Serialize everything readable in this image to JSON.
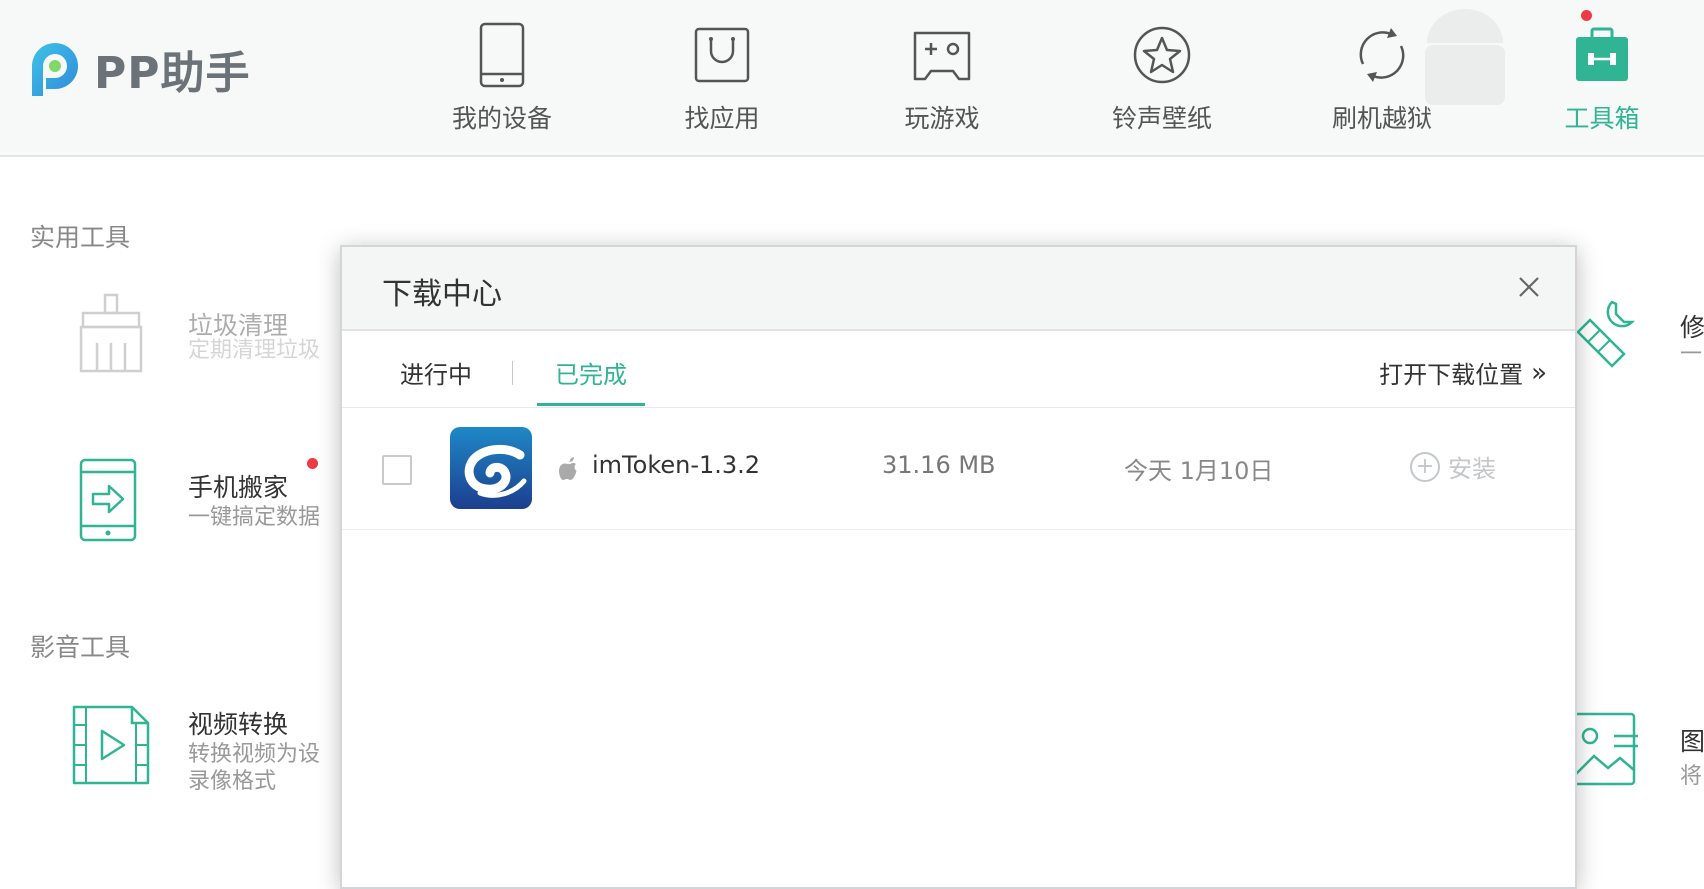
{
  "app": {
    "logo_text": "PP助手"
  },
  "nav": {
    "items": [
      {
        "label": "我的设备",
        "icon": "phone-icon"
      },
      {
        "label": "找应用",
        "icon": "shopping-bag-icon"
      },
      {
        "label": "玩游戏",
        "icon": "gamepad-icon"
      },
      {
        "label": "铃声壁纸",
        "icon": "star-icon"
      },
      {
        "label": "刷机越狱",
        "icon": "refresh-icon"
      },
      {
        "label": "工具箱",
        "icon": "toolbox-icon",
        "active": true
      }
    ]
  },
  "sections": {
    "utility_title": "实用工具",
    "media_title": "影音工具"
  },
  "tools": {
    "junk_clean": {
      "title": "垃圾清理",
      "desc": "定期清理垃圾"
    },
    "phone_move": {
      "title": "手机搬家",
      "desc": "一键搞定数据"
    },
    "video_convert": {
      "title": "视频转换",
      "desc1": "转换视频为设",
      "desc2": "录像格式"
    },
    "right_top": {
      "title": "修",
      "desc": "一"
    },
    "right_bottom": {
      "title": "图",
      "desc": "将"
    }
  },
  "modal": {
    "title": "下载中心",
    "tabs": {
      "in_progress": "进行中",
      "completed": "已完成"
    },
    "open_location": "打开下载位置",
    "items": [
      {
        "name": "imToken-1.3.2",
        "size": "31.16 MB",
        "date": "今天 1月10日",
        "action": "安装"
      }
    ]
  },
  "colors": {
    "accent": "#2fb594",
    "badge": "#ee3a45",
    "app_icon_top": "#1e88c7",
    "app_icon_bottom": "#1c3f8f"
  }
}
